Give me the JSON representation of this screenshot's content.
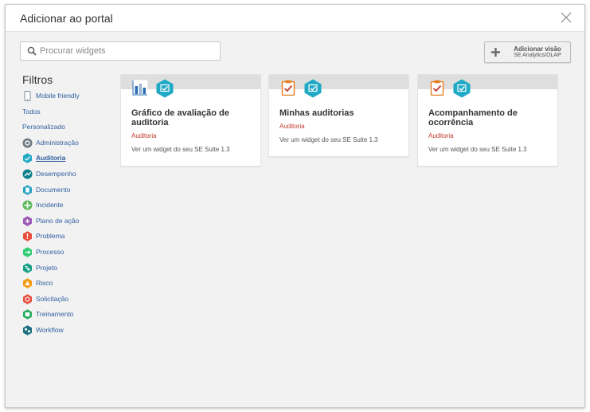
{
  "modal": {
    "title": "Adicionar ao portal",
    "close_icon": "close-icon"
  },
  "search": {
    "placeholder": "Procurar widgets",
    "value": "",
    "icon": "search-icon"
  },
  "add_view_button": {
    "title": "Adicionar visão",
    "subtitle": "SE Analytics/OLAP",
    "icon": "plus-icon"
  },
  "filters": {
    "title": "Filtros",
    "items": [
      {
        "label": "Mobile friendly",
        "icon": "mobile-icon",
        "color": "#7d8a94"
      },
      {
        "label": "Todos",
        "icon": "",
        "color": ""
      },
      {
        "label": "Personalizado",
        "icon": "",
        "color": ""
      },
      {
        "label": "Administração",
        "icon": "gear-icon",
        "color": "#6e7b85"
      },
      {
        "label": "Auditoria",
        "icon": "audit-icon",
        "color": "#1fa9c4"
      },
      {
        "label": "Desempenho",
        "icon": "performance-icon",
        "color": "#0e7f8c"
      },
      {
        "label": "Documento",
        "icon": "document-icon",
        "color": "#27a3c2"
      },
      {
        "label": "Incidente",
        "icon": "incident-icon",
        "color": "#5cb85c"
      },
      {
        "label": "Plano de ação",
        "icon": "action-plan-icon",
        "color": "#9b59b6"
      },
      {
        "label": "Problema",
        "icon": "problem-icon",
        "color": "#e74c3c"
      },
      {
        "label": "Processo",
        "icon": "process-icon",
        "color": "#2ecc71"
      },
      {
        "label": "Projeto",
        "icon": "project-icon",
        "color": "#16a085"
      },
      {
        "label": "Risco",
        "icon": "risk-icon",
        "color": "#f39c12"
      },
      {
        "label": "Solicitação",
        "icon": "request-icon",
        "color": "#e74c3c"
      },
      {
        "label": "Treinamento",
        "icon": "training-icon",
        "color": "#27ae60"
      },
      {
        "label": "Workflow",
        "icon": "workflow-icon",
        "color": "#1b6f80"
      }
    ],
    "active": "Auditoria"
  },
  "cards": [
    {
      "title": "Gráfico de avaliação de auditoria",
      "category": "Auditoria",
      "description": "Ver um widget do seu SE Suite 1.3",
      "icon": "bar-chart-icon",
      "module_icon": "audit-module-icon"
    },
    {
      "title": "Minhas auditorias",
      "category": "Auditoria",
      "description": "Ver um widget do seu SE Suite 1.3",
      "icon": "clipboard-check-icon",
      "module_icon": "audit-module-icon"
    },
    {
      "title": "Acompanhamento de ocorrência",
      "category": "Auditoria",
      "description": "Ver um widget do seu SE Suite 1.3",
      "icon": "clipboard-check-icon",
      "module_icon": "audit-module-icon"
    }
  ],
  "colors": {
    "link": "#2f5fa0",
    "category": "#c0392b",
    "module_teal": "#1fa9c4",
    "clipboard_orange": "#e67e22",
    "chart_blue": "#2a6db5"
  }
}
